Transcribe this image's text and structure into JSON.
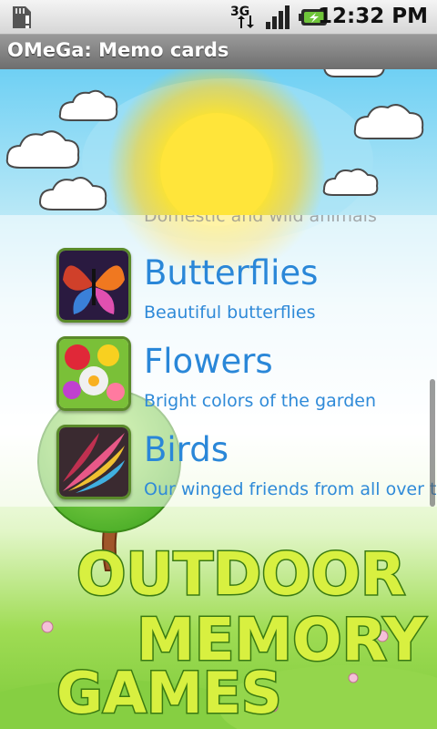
{
  "status_bar": {
    "time": "12:32 PM",
    "network_label": "3G",
    "icons": [
      "sd-card-icon",
      "network-3g-icon",
      "signal-icon",
      "battery-charging-icon"
    ]
  },
  "app": {
    "title": "OMeGa: Memo cards"
  },
  "list": {
    "partial_item_desc": "Domestic and wild animals",
    "items": [
      {
        "name": "Butterflies",
        "description": "Beautiful butterflies",
        "icon": "butterflies-thumbnail"
      },
      {
        "name": "Flowers",
        "description": "Bright colors of the garden",
        "icon": "flowers-thumbnail"
      },
      {
        "name": "Birds",
        "description": "Our winged friends from all over the world",
        "icon": "birds-thumbnail"
      }
    ]
  },
  "logo": {
    "line1": "OUTDOOR",
    "line2": "MEMORY",
    "line3": "GAMES"
  },
  "colors": {
    "item_title": "#2a87d8",
    "item_desc": "#2f8ad8",
    "logo_fill": "#d8f040",
    "logo_outline": "#3a7a12"
  }
}
